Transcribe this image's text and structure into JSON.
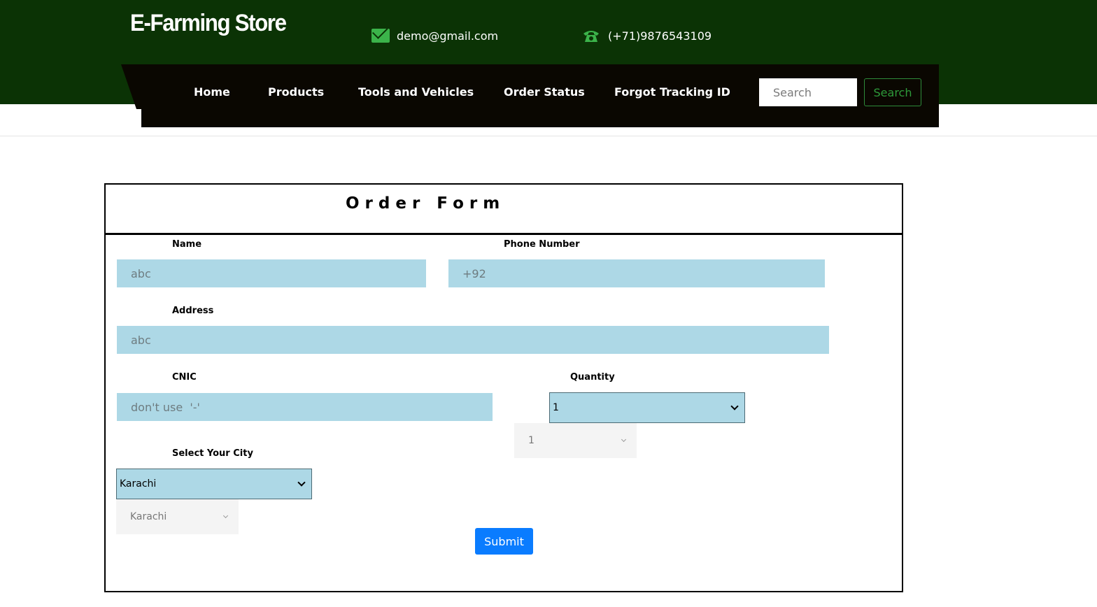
{
  "header": {
    "brand": "E-Farming Store",
    "email": "demo@gmail.com",
    "phone": "(+71)9876543109",
    "icons": {
      "email": "envelope-icon",
      "phone": "telephone-icon"
    },
    "colors": {
      "top_bg": "#0b3305",
      "nav_bg": "#0a0701",
      "icon_green": "#3bb34a"
    }
  },
  "nav": {
    "items": [
      {
        "label": "Home"
      },
      {
        "label": "Products"
      },
      {
        "label": "Tools and Vehicles"
      },
      {
        "label": "Order Status"
      },
      {
        "label": "Forgot Tracking ID"
      }
    ],
    "search_placeholder": "Search",
    "search_button": "Search"
  },
  "form": {
    "title": "Order Form",
    "name": {
      "label": "Name",
      "placeholder": "abc"
    },
    "phone": {
      "label": "Phone Number",
      "placeholder": "+92"
    },
    "address": {
      "label": "Address",
      "placeholder": "abc"
    },
    "cnic": {
      "label": "CNIC",
      "placeholder": "don't use  '-'"
    },
    "quantity": {
      "label": "Quantity",
      "selected": "1",
      "nice_selected": "1"
    },
    "city": {
      "label": "Select Your City",
      "selected": "Karachi",
      "nice_selected": "Karachi"
    },
    "submit_label": "Submit",
    "colors": {
      "field_bg": "#add8e6",
      "submit_bg": "#0a7cff"
    }
  }
}
